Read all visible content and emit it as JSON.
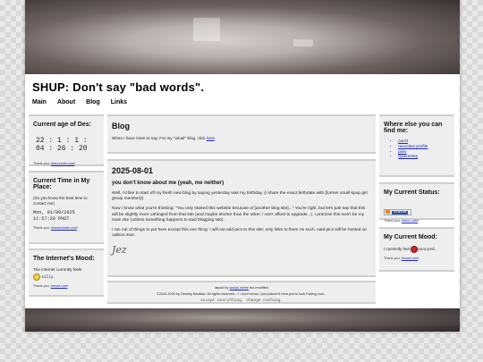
{
  "site": {
    "title": "SHUP: Don't say \"bad words\".",
    "nav": [
      "Main",
      "About",
      "Blog",
      "Links"
    ]
  },
  "left": {
    "age": {
      "title": "Current age of Des:",
      "value": "22 : 1 : 1 : 04 : 26 : 20",
      "credit_prefix": "Thank you, ",
      "credit_link": "tickcounter.com",
      "credit_suffix": "!"
    },
    "time": {
      "title": "Current Time in My Place:",
      "note": "(So you know the best time to contact me)",
      "datetime": "Mon, 01/09/2025",
      "clock": "11:57:20 PHST",
      "credit_prefix": "Thank you, ",
      "credit_link": "timeanddate.com",
      "credit_suffix": "!"
    },
    "mood": {
      "title": "The Internet's Mood:",
      "text": "The internet currently feels",
      "mood": "silly.",
      "credit_prefix": "Thank you, ",
      "credit_link": "imood.com",
      "credit_suffix": "!"
    }
  },
  "main": {
    "blog": {
      "title": "Blog",
      "text": "When I have more to say. For my \"usual\" blog, click ",
      "link": "here",
      "text_end": "."
    },
    "post": {
      "date": "2025-08-01",
      "heading": "you don't know about me (yeah, me neither)",
      "paragraphs": [
        "Well, I'd like to start off my fresh new blog by saying yesterday was my birthday. (I share the exact birthdate with [former small kpop girl group member]!)",
        "Now I know what you're thinking: \"You only started this website because of [another blog site]...\" You're right, but let's just say that this will be slightly more unhinged from that site (and maybe shorter than the other; i can't afford to upgrade...). I promise this won't be my main site (unless something happens to said blogging site).",
        "I ran out of things to put here except this one thing: I will not add pics to this site; only links to them As such, said pics will be hosted on catbox.moe."
      ],
      "signature": "Jez"
    },
    "footer": {
      "layout_prefix": "layout by ",
      "layout_link": "sadgrl.online",
      "layout_suffix": " but modified",
      "copyright": "©2024-2025 by Destiny Bautista. All rights reserved...? I don't know, I just placed it here just to look f*cking cool...",
      "tagline": "Accept everything. Change nothing."
    }
  },
  "right": {
    "find": {
      "title": "Where else you can find me:",
      "links": [
        "carrd",
        "neocities profile",
        "pixiv",
        "SpaceHey"
      ]
    },
    "status": {
      "title": "My Current Status:",
      "badge": "status",
      "credit_prefix": "Thank you, ",
      "credit_link": "status.cafe",
      "credit_suffix": "!"
    },
    "mood": {
      "title": "My Current Mood:",
      "text": "I currently feel",
      "mood": "annoyed.",
      "credit_prefix": "Thank you, ",
      "credit_link": "imood.com",
      "credit_suffix": "!"
    }
  }
}
